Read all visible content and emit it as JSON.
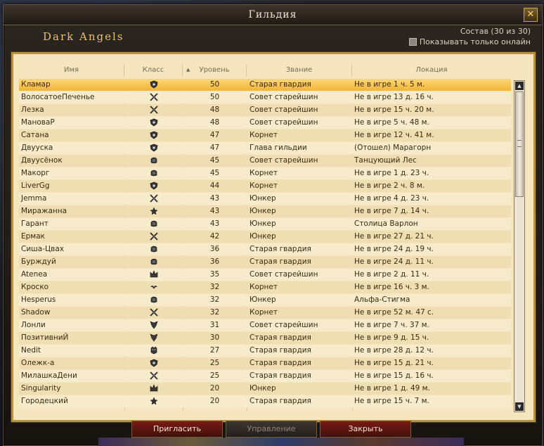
{
  "window": {
    "title": "Гильдия",
    "close_label": "✕"
  },
  "guild": {
    "name": "Dark Angels",
    "roster_count": "Состав (30 из 30)",
    "online_only_label": "Показывать только онлайн"
  },
  "columns": [
    "Имя",
    "Класс",
    "Уровень",
    "Звание",
    "Локация"
  ],
  "members": [
    {
      "name": "Кламар",
      "class_icon": "shield-icon",
      "level": "50",
      "rank": "Старая гвардия",
      "location": "Не в игре 1 ч. 5 м.",
      "selected": true
    },
    {
      "name": "ВолосатоеПеченье",
      "class_icon": "crossed-swords-icon",
      "level": "50",
      "rank": "Совет старейшин",
      "location": "Не в игре 13 д. 16 ч."
    },
    {
      "name": "Лезка",
      "class_icon": "crossed-swords-icon",
      "level": "48",
      "rank": "Совет старейшин",
      "location": "Не в игре 15 ч. 20 м."
    },
    {
      "name": "МановаР",
      "class_icon": "shield-icon",
      "level": "48",
      "rank": "Совет старейшин",
      "location": "Не в игре 5 ч. 48 м."
    },
    {
      "name": "Сатана",
      "class_icon": "shield-icon",
      "level": "47",
      "rank": "Корнет",
      "location": "Не в игре 12 ч. 41 м."
    },
    {
      "name": "Двууска",
      "class_icon": "shield-icon",
      "level": "47",
      "rank": "Глава гильдии",
      "location": "(Отошел) Марагорн"
    },
    {
      "name": "Двуусёнок",
      "class_icon": "fist-icon",
      "level": "45",
      "rank": "Совет старейшин",
      "location": "Танцующий Лес"
    },
    {
      "name": "Макорг",
      "class_icon": "fist-icon",
      "level": "45",
      "rank": "Корнет",
      "location": "Не в игре 1 д. 23 ч."
    },
    {
      "name": "LiverGg",
      "class_icon": "shield-icon",
      "level": "44",
      "rank": "Корнет",
      "location": "Не в игре 2 ч. 8 м."
    },
    {
      "name": "Jemma",
      "class_icon": "crossed-swords-icon",
      "level": "43",
      "rank": "Юнкер",
      "location": "Не в игре 4 д. 23 ч."
    },
    {
      "name": "Миражанна",
      "class_icon": "star-icon",
      "level": "43",
      "rank": "Юнкер",
      "location": "Не в игре 7 д. 14 ч."
    },
    {
      "name": "Гарант",
      "class_icon": "fist-icon",
      "level": "43",
      "rank": "Юнкер",
      "location": "Столица Варлон"
    },
    {
      "name": "Ермак",
      "class_icon": "crossed-swords-icon",
      "level": "42",
      "rank": "Юнкер",
      "location": "Не в игре 27 д. 21 ч."
    },
    {
      "name": "Сиша-Цвах",
      "class_icon": "fist-icon",
      "level": "36",
      "rank": "Старая гвардия",
      "location": "Не в игре 24 д. 19 ч."
    },
    {
      "name": "Бурждуй",
      "class_icon": "fist-icon",
      "level": "36",
      "rank": "Старая гвардия",
      "location": "Не в игре 24 д. 11 ч."
    },
    {
      "name": "Atenea",
      "class_icon": "crown-icon",
      "level": "35",
      "rank": "Совет старейшин",
      "location": "Не в игре 2 д. 11 ч."
    },
    {
      "name": "Кроско",
      "class_icon": "bird-icon",
      "level": "32",
      "rank": "Корнет",
      "location": "Не в игре 16 ч. 3 м."
    },
    {
      "name": "Hesperus",
      "class_icon": "fist-icon",
      "level": "32",
      "rank": "Юнкер",
      "location": "Альфа-Стигма"
    },
    {
      "name": "Shadow",
      "class_icon": "crossed-swords-icon",
      "level": "32",
      "rank": "Корнет",
      "location": "Не в игре 52 м. 47 с."
    },
    {
      "name": "Лонли",
      "class_icon": "wings-icon",
      "level": "31",
      "rank": "Совет старейшин",
      "location": "Не в игре 7 ч. 37 м."
    },
    {
      "name": "ПозитивниЙ",
      "class_icon": "wings-icon",
      "level": "30",
      "rank": "Старая гвардия",
      "location": "Не в игре 9 д. 15 ч."
    },
    {
      "name": "Nedit",
      "class_icon": "beast-icon",
      "level": "27",
      "rank": "Старая гвардия",
      "location": "Не в игре 28 д. 12 ч."
    },
    {
      "name": "Олежк-а",
      "class_icon": "shield-icon",
      "level": "25",
      "rank": "Старая гвардия",
      "location": "Не в игре 15 д. 21 ч."
    },
    {
      "name": "МилашкаДени",
      "class_icon": "crossed-swords-icon",
      "level": "25",
      "rank": "Старая гвардия",
      "location": "Не в игре 15 д. 16 ч."
    },
    {
      "name": "Singularity",
      "class_icon": "crown-icon",
      "level": "20",
      "rank": "Юнкер",
      "location": "Не в игре 1 д. 49 м."
    },
    {
      "name": "Городецкий",
      "class_icon": "star-icon",
      "level": "20",
      "rank": "Старая гвардия",
      "location": "Не в игре 15 ч. 7 м."
    }
  ],
  "buttons": {
    "invite": "Пригласить",
    "manage": "Управление",
    "close": "Закрыть"
  },
  "colors": {
    "accent": "#e8c070",
    "parchment": "#f6e6c0",
    "selected": "#f2b437",
    "button_red": "#7a1a14"
  }
}
